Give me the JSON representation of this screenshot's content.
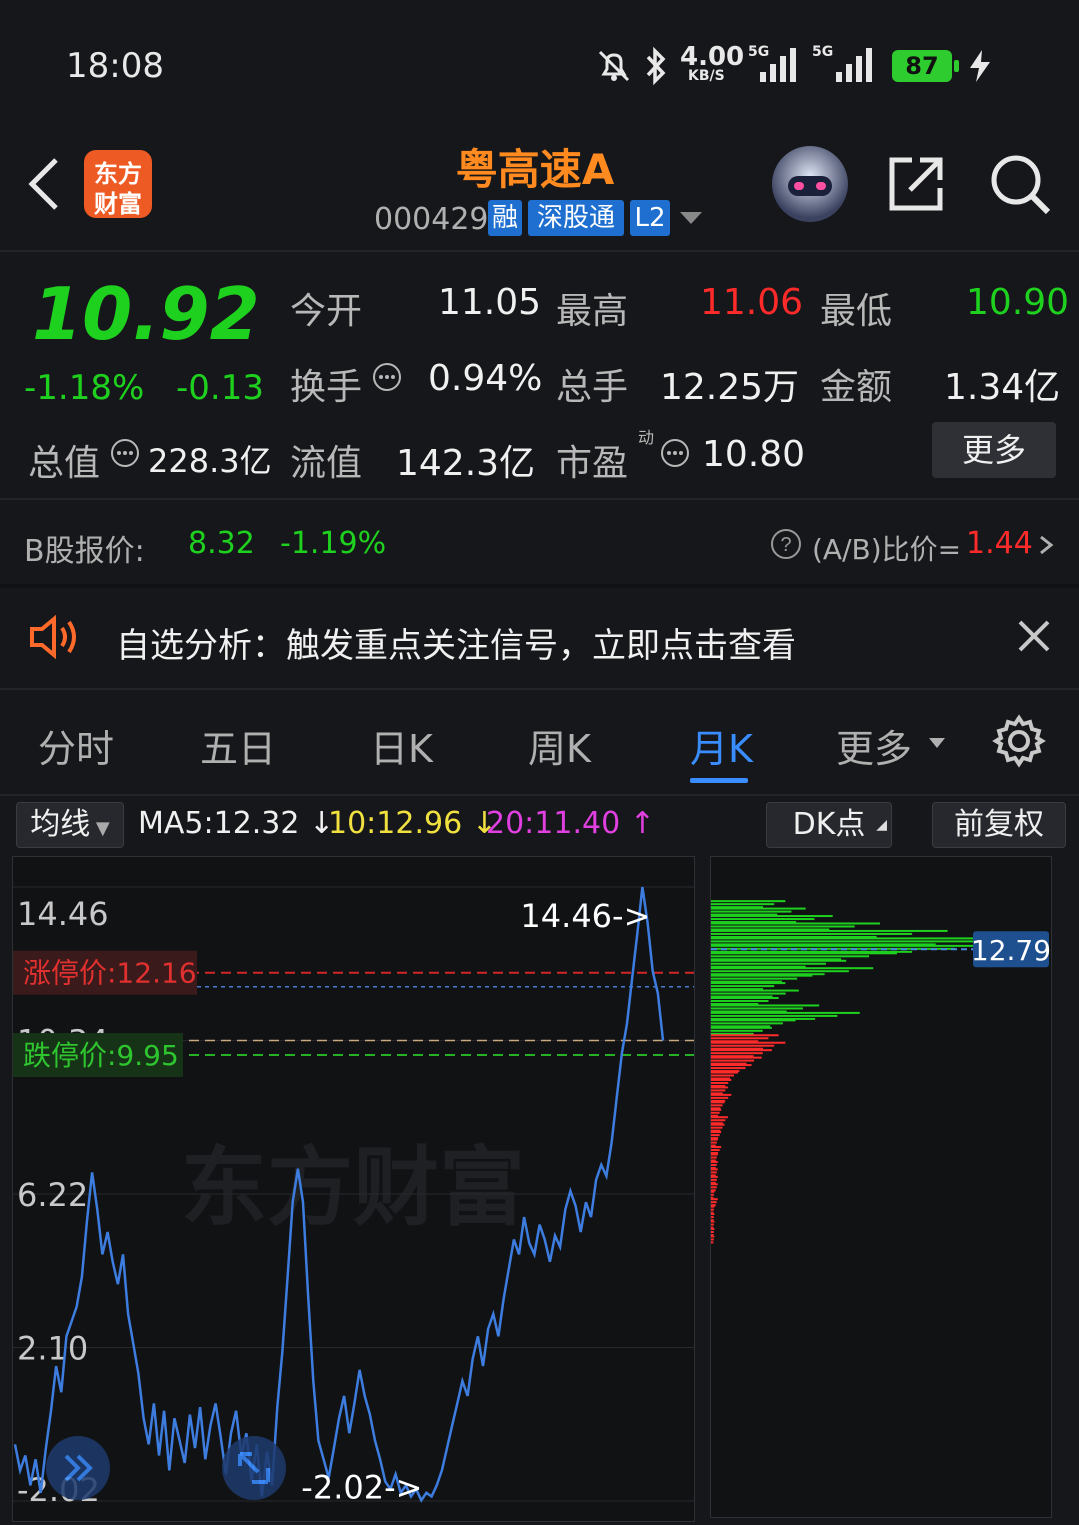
{
  "status": {
    "time": "18:08",
    "net_speed": "4.00",
    "net_unit": "KB/S",
    "signal1": "5G",
    "signal2": "5G",
    "battery": "87"
  },
  "header": {
    "logo_line1": "东方",
    "logo_line2": "财富",
    "stock_name": "粤高速A",
    "stock_code": "000429",
    "badge_rong": "融",
    "badge_sgt": "深股通",
    "badge_l2": "L2"
  },
  "quote": {
    "price": "10.92",
    "change_pct": "-1.18%",
    "change": "-0.13",
    "open_label": "今开",
    "open": "11.05",
    "high_label": "最高",
    "high": "11.06",
    "low_label": "最低",
    "low": "10.90",
    "turnover_label": "换手",
    "turnover": "0.94%",
    "volume_label": "总手",
    "volume": "12.25万",
    "amount_label": "金额",
    "amount": "1.34亿",
    "mktcap_label": "总值",
    "mktcap": "228.3亿",
    "float_label": "流值",
    "float": "142.3亿",
    "pe_label": "市盈",
    "pe_sup": "动",
    "pe": "10.80",
    "more": "更多",
    "b_label": "B股报价:",
    "b_price": "8.32",
    "b_pct": "-1.19%",
    "ab_label": "(A/B)比价=",
    "ab_value": "1.44"
  },
  "notice": {
    "text": "自选分析：触发重点关注信号，立即点击查看"
  },
  "tabs": [
    {
      "label": "分时"
    },
    {
      "label": "五日"
    },
    {
      "label": "日K"
    },
    {
      "label": "周K"
    },
    {
      "label": "月K"
    },
    {
      "label": "更多"
    }
  ],
  "chart_toolbar": {
    "ma_select": "均线",
    "ma5": "MA5:12.32",
    "ma10": "10:12.96",
    "ma20": "20:11.40",
    "dk": "DK点",
    "adjust": "前复权"
  },
  "colors": {
    "up": "#ff2a2a",
    "down": "#1fd11f",
    "accent": "#ff8a1f",
    "line": "#3d7de0",
    "ma10": "#f0e040",
    "ma20": "#e040e0",
    "tab_active": "#3a8dff"
  },
  "chart_data": {
    "type": "line",
    "y_labels": [
      "14.46",
      "10.34",
      "6.22",
      "2.10",
      "-2.02"
    ],
    "ylim": [
      -2.02,
      14.46
    ],
    "limit_up_label": "涨停价:12.16",
    "limit_up": 12.16,
    "limit_down_label": "跌停价:9.95",
    "limit_down": 9.95,
    "current_level": 10.34,
    "max_marker": "14.46->",
    "min_marker": "-2.02->",
    "profile_price_label": "12.79",
    "watermark": "东方财富",
    "series": [
      {
        "values": [
          -0.5,
          -1.2,
          -0.8,
          -1.6,
          -0.9,
          -1.8,
          -0.6,
          0.4,
          1.6,
          0.9,
          2.4,
          2.8,
          3.2,
          4.0,
          5.5,
          6.8,
          5.8,
          4.6,
          5.2,
          4.4,
          3.8,
          4.6,
          3.0,
          2.2,
          1.4,
          0.2,
          -0.5,
          0.6,
          -0.8,
          0.4,
          -1.2,
          0.2,
          -0.4,
          -1.0,
          0.3,
          -0.6,
          0.5,
          -0.9,
          0.0,
          0.6,
          -0.3,
          -1.3,
          -0.2,
          0.4,
          -0.8,
          -0.2,
          -1.5,
          -0.5,
          -1.9,
          -0.7,
          -1.6,
          0.5,
          2.0,
          4.0,
          6.0,
          6.9,
          6.0,
          3.5,
          1.2,
          -0.4,
          -0.9,
          -1.4,
          -0.6,
          0.2,
          0.8,
          -0.2,
          0.6,
          1.5,
          0.8,
          0.3,
          -0.4,
          -0.9,
          -1.5,
          -1.7,
          -1.3,
          -1.8,
          -1.6,
          -1.9,
          -1.7,
          -2.0,
          -1.8,
          -1.9,
          -1.6,
          -1.2,
          -0.6,
          0.0,
          0.6,
          1.2,
          0.8,
          1.8,
          2.4,
          1.6,
          2.6,
          3.0,
          2.4,
          3.4,
          4.2,
          5.0,
          4.6,
          5.6,
          4.9,
          4.6,
          5.4,
          5.0,
          4.4,
          5.1,
          4.8,
          5.8,
          6.3,
          5.9,
          5.2,
          6.0,
          5.6,
          6.6,
          7.0,
          6.7,
          7.6,
          8.8,
          10.0,
          10.8,
          12.0,
          13.2,
          14.46,
          13.5,
          12.2,
          11.6,
          10.34
        ]
      }
    ],
    "profile": {
      "green_levels": [
        14.0,
        13.8,
        13.6,
        13.4,
        13.2,
        13.0,
        12.8,
        12.6,
        12.4,
        12.2,
        12.0,
        11.8,
        11.6,
        11.4,
        11.2,
        11.0,
        10.8,
        10.6
      ],
      "green_values": [
        0.22,
        0.28,
        0.36,
        0.5,
        0.7,
        0.95,
        0.85,
        0.55,
        0.4,
        0.48,
        0.3,
        0.22,
        0.26,
        0.2,
        0.32,
        0.44,
        0.25,
        0.18
      ],
      "red_levels": [
        10.4,
        10.2,
        10.0,
        9.8,
        9.6,
        9.4,
        9.2,
        9.0,
        8.8,
        8.6,
        8.4,
        8.2,
        8.0,
        7.8,
        7.6,
        7.4,
        7.2,
        7.0,
        6.8,
        6.6,
        6.4,
        6.2,
        6.0,
        5.8,
        5.6,
        5.4,
        5.2,
        5.0
      ],
      "red_values": [
        0.2,
        0.22,
        0.18,
        0.15,
        0.12,
        0.08,
        0.06,
        0.05,
        0.06,
        0.04,
        0.03,
        0.05,
        0.04,
        0.03,
        0.02,
        0.03,
        0.02,
        0.02,
        0.02,
        0.02,
        0.02,
        0.01,
        0.02,
        0.01,
        0.01,
        0.01,
        0.01,
        0.01
      ]
    }
  }
}
